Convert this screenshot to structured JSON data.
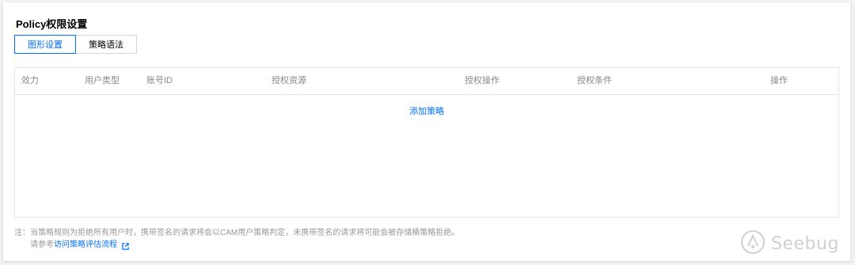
{
  "title": "Policy权限设置",
  "tabs": [
    {
      "label": "图形设置",
      "active": true
    },
    {
      "label": "策略语法",
      "active": false
    }
  ],
  "table": {
    "columns": [
      "效力",
      "用户类型",
      "账号ID",
      "授权资源",
      "授权操作",
      "授权条件",
      "操作"
    ],
    "add_link": "添加策略"
  },
  "note": {
    "line1": "注：当策略规则为拒绝所有用户时，携带签名的请求将会以CAM用户策略判定，未携带签名的请求将可能会被存储桶策略拒绝。",
    "line2_prefix": "请参考",
    "line2_link": "访问策略评估流程",
    "link_icon": "external-link-icon"
  },
  "watermark": {
    "text": "Seebug",
    "icon": "seebug-logo"
  },
  "colors": {
    "accent": "#006eff",
    "muted": "#999999"
  }
}
